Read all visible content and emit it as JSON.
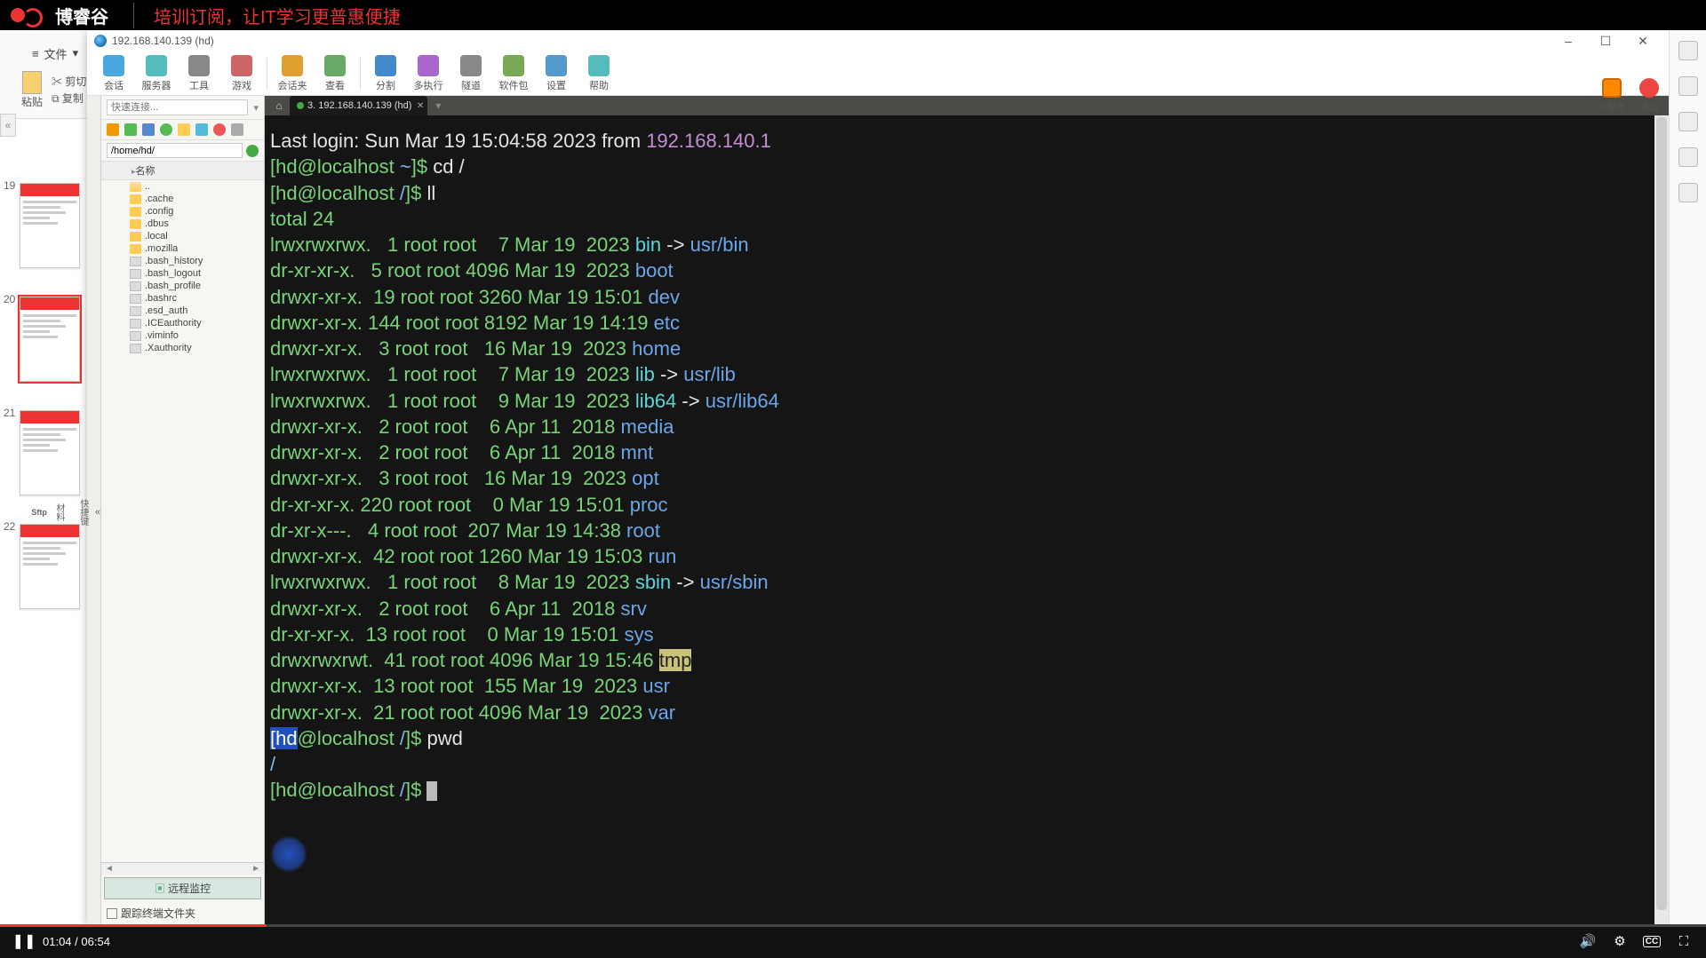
{
  "brand": {
    "name": "博睿谷",
    "slogan": "培训订阅，让IT学习更普惠便捷"
  },
  "under": {
    "menu_file": "文件",
    "paste": "粘贴",
    "cut": "剪切",
    "copy": "复制"
  },
  "ssh_window": {
    "title": "192.168.140.139 (hd)",
    "ctrl_min": "–",
    "ctrl_max": "☐",
    "ctrl_close": "✕"
  },
  "toolbar": [
    {
      "label": "会话",
      "color": "#4aa8e0"
    },
    {
      "label": "服务器",
      "color": "#5bb"
    },
    {
      "label": "工具",
      "color": "#888"
    },
    {
      "label": "游戏",
      "color": "#c66"
    },
    {
      "label": "会话夹",
      "color": "#e0a030"
    },
    {
      "label": "查看",
      "color": "#6a6"
    },
    {
      "label": "分割",
      "color": "#48c"
    },
    {
      "label": "多执行",
      "color": "#a6c"
    },
    {
      "label": "隧道",
      "color": "#888"
    },
    {
      "label": "软件包",
      "color": "#7a5"
    },
    {
      "label": "设置",
      "color": "#59c"
    },
    {
      "label": "帮助",
      "color": "#5bb"
    }
  ],
  "xserv": {
    "a": "X 服务器",
    "b": "退出"
  },
  "quick": {
    "placeholder": "快速连接...",
    "path": "/home/hd/",
    "hdr": "名称"
  },
  "files": [
    {
      "name": "..",
      "type": "folder-open"
    },
    {
      "name": ".cache",
      "type": "folder"
    },
    {
      "name": ".config",
      "type": "folder"
    },
    {
      "name": ".dbus",
      "type": "folder"
    },
    {
      "name": ".local",
      "type": "folder"
    },
    {
      "name": ".mozilla",
      "type": "folder"
    },
    {
      "name": ".bash_history",
      "type": "file"
    },
    {
      "name": ".bash_logout",
      "type": "file"
    },
    {
      "name": ".bash_profile",
      "type": "file"
    },
    {
      "name": ".bashrc",
      "type": "file"
    },
    {
      "name": ".esd_auth",
      "type": "file"
    },
    {
      "name": ".ICEauthority",
      "type": "file"
    },
    {
      "name": ".viminfo",
      "type": "file"
    },
    {
      "name": ".Xauthority",
      "type": "file"
    }
  ],
  "remote_btn": "远程监控",
  "trace": "跟踪终端文件夹",
  "tab": {
    "label": "3. 192.168.140.139 (hd)"
  },
  "term": {
    "last_login_a": "Last login: ",
    "last_login_b": "Sun Mar 19 15:04:58 2023 ",
    "last_login_c": "from ",
    "last_login_ip": "192.168.140.1",
    "p1_a": "[hd@localhost ",
    "p1_b": "~",
    "p1_c": "]$ ",
    "cmd1": "cd /",
    "p2_a": "[hd@localhost ",
    "p2_b": "/",
    "p2_c": "]$ ",
    "cmd2": "ll",
    "total": "total 24",
    "rows": [
      {
        "perm": "lrwxrwxrwx.",
        "n": "  1",
        "sz": "   7",
        "dt": "Mar 19  2023",
        "name": "bin",
        "link": " -> usr/bin",
        "cls": "c-cyan"
      },
      {
        "perm": "dr-xr-xr-x.",
        "n": "  5",
        "sz": "4096",
        "dt": "Mar 19  2023",
        "name": "boot",
        "link": "",
        "cls": "c-blue"
      },
      {
        "perm": "drwxr-xr-x.",
        "n": " 19",
        "sz": "3260",
        "dt": "Mar 19 15:01",
        "name": "dev",
        "link": "",
        "cls": "c-blue"
      },
      {
        "perm": "drwxr-xr-x.",
        "n": "144",
        "sz": "8192",
        "dt": "Mar 19 14:19",
        "name": "etc",
        "link": "",
        "cls": "c-blue"
      },
      {
        "perm": "drwxr-xr-x.",
        "n": "  3",
        "sz": "  16",
        "dt": "Mar 19  2023",
        "name": "home",
        "link": "",
        "cls": "c-blue"
      },
      {
        "perm": "lrwxrwxrwx.",
        "n": "  1",
        "sz": "   7",
        "dt": "Mar 19  2023",
        "name": "lib",
        "link": " -> usr/lib",
        "cls": "c-cyan"
      },
      {
        "perm": "lrwxrwxrwx.",
        "n": "  1",
        "sz": "   9",
        "dt": "Mar 19  2023",
        "name": "lib64",
        "link": " -> usr/lib64",
        "cls": "c-cyan"
      },
      {
        "perm": "drwxr-xr-x.",
        "n": "  2",
        "sz": "   6",
        "dt": "Apr 11  2018",
        "name": "media",
        "link": "",
        "cls": "c-blue"
      },
      {
        "perm": "drwxr-xr-x.",
        "n": "  2",
        "sz": "   6",
        "dt": "Apr 11  2018",
        "name": "mnt",
        "link": "",
        "cls": "c-blue"
      },
      {
        "perm": "drwxr-xr-x.",
        "n": "  3",
        "sz": "  16",
        "dt": "Mar 19  2023",
        "name": "opt",
        "link": "",
        "cls": "c-blue"
      },
      {
        "perm": "dr-xr-xr-x.",
        "n": "220",
        "sz": "   0",
        "dt": "Mar 19 15:01",
        "name": "proc",
        "link": "",
        "cls": "c-blue"
      },
      {
        "perm": "dr-xr-x---.",
        "n": "  4",
        "sz": " 207",
        "dt": "Mar 19 14:38",
        "name": "root",
        "link": "",
        "cls": "c-blue"
      },
      {
        "perm": "drwxr-xr-x.",
        "n": " 42",
        "sz": "1260",
        "dt": "Mar 19 15:03",
        "name": "run",
        "link": "",
        "cls": "c-blue"
      },
      {
        "perm": "lrwxrwxrwx.",
        "n": "  1",
        "sz": "   8",
        "dt": "Mar 19  2023",
        "name": "sbin",
        "link": " -> usr/sbin",
        "cls": "c-cyan"
      },
      {
        "perm": "drwxr-xr-x.",
        "n": "  2",
        "sz": "   6",
        "dt": "Apr 11  2018",
        "name": "srv",
        "link": "",
        "cls": "c-blue"
      },
      {
        "perm": "dr-xr-xr-x.",
        "n": " 13",
        "sz": "   0",
        "dt": "Mar 19 15:01",
        "name": "sys",
        "link": "",
        "cls": "c-blue"
      },
      {
        "perm": "drwxrwxrwt.",
        "n": " 41",
        "sz": "4096",
        "dt": "Mar 19 15:46",
        "name": "tmp",
        "link": "",
        "cls": "c-hl"
      },
      {
        "perm": "drwxr-xr-x.",
        "n": " 13",
        "sz": " 155",
        "dt": "Mar 19  2023",
        "name": "usr",
        "link": "",
        "cls": "c-blue"
      },
      {
        "perm": "drwxr-xr-x.",
        "n": " 21",
        "sz": "4096",
        "dt": "Mar 19  2023",
        "name": "var",
        "link": "",
        "cls": "c-blue"
      }
    ],
    "p3_a": "[hd",
    "p3_b": "@localhost ",
    "p3_c": "/",
    "p3_d": "]$ ",
    "cmd3": "pwd",
    "out3": "/",
    "p4_a": "[hd@localhost ",
    "p4_b": "/",
    "p4_c": "]$ "
  },
  "slides": [
    19,
    20,
    21,
    22
  ],
  "video": {
    "cur": "01:04",
    "dur": "06:54",
    "pause": "❚❚",
    "cc": "CC",
    "sep": " / "
  }
}
